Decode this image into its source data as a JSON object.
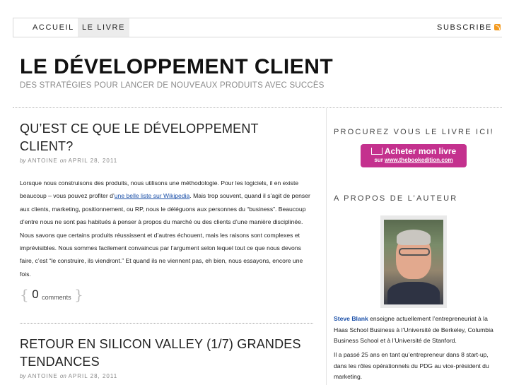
{
  "nav": {
    "items": [
      {
        "label": "ACCUEIL"
      },
      {
        "label": "LE LIVRE"
      }
    ],
    "subscribe": "SUBSCRIBE"
  },
  "site": {
    "title": "LE DÉVELOPPEMENT CLIENT",
    "description": "DES STRATÉGIES POUR LANCER DE NOUVEAUX PRODUITS AVEC SUCCÈS"
  },
  "posts": [
    {
      "title": "QU’EST CE QUE LE DÉVELOPPEMENT CLIENT?",
      "by": "by",
      "author": "ANTOINE",
      "on": "on",
      "date": "APRIL 28, 2011",
      "body_before_link": "Lorsque nous construisons des produits, nous utilisons une méthodologie. Pour les logiciels, il en existe beaucoup – vous pouvez profiter d’",
      "link": "une belle liste sur Wikipedia",
      "body_after_link": ". Mais trop souvent, quand il s’agit de penser aux clients, marketing, positionnement, ou RP, nous le déléguons aux personnes du “business”. Beaucoup d’entre nous ne sont pas habitués à penser à propos du marché ou des clients d’une manière disciplinée. Nous savons que certains produits réussissent et d’autres échouent, mais les raisons sont complexes et imprévisibles. Nous sommes facilement convaincus par l’argument selon lequel tout ce que nous devons faire, c’est “le construire, ils viendront.” Et quand ils ne viennent pas, eh bien, nous essayons, encore une fois.",
      "comment_count": "0",
      "comment_label": "comments"
    },
    {
      "title": "RETOUR EN SILICON VALLEY (1/7) GRANDES TENDANCES",
      "by": "by",
      "author": "ANTOINE",
      "on": "on",
      "date": "APRIL 28, 2011"
    }
  ],
  "sidebar": {
    "buy_heading": "PROCUREZ VOUS LE LIVRE ICI!",
    "buy_button_line1": "Acheter mon livre",
    "buy_button_sur": "sur",
    "buy_button_site": "www.thebookedition.com",
    "about_heading": "A PROPOS DE L’AUTEUR",
    "bio_name": "Steve Blank",
    "bio_text1": " enseigne actuellement l’entrepreneuriat à la Haas School Business à l’Université de Berkeley, Columbia Business School et à l’Université de Stanford.",
    "bio_text2": "Il a passé 25 ans en tant qu’entrepreneur dans 8 start-up, dans les rôles opérationnels du PDG au vice-président du marketing."
  },
  "colors": {
    "accent_link": "#1a4fa8",
    "buy_button": "#c4318e",
    "rss": "#f39a1f"
  }
}
